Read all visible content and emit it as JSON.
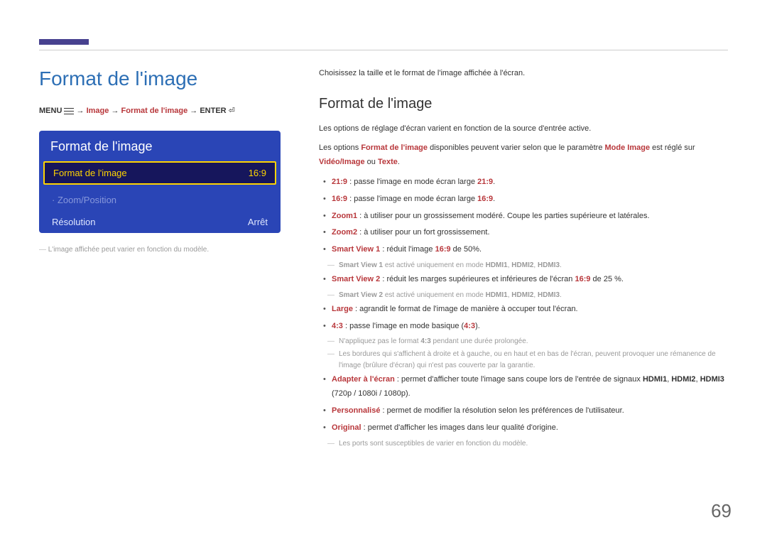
{
  "page_number": "69",
  "left": {
    "heading": "Format de l'image",
    "breadcrumb": {
      "menu": "MENU",
      "arrow": " → ",
      "image": "Image",
      "format": "Format de l'image",
      "enter": "ENTER",
      "enter_glyph": "⏎"
    },
    "panel": {
      "title": "Format de l'image",
      "selected_label": "Format de l'image",
      "selected_value": "16:9",
      "row_zoom": "· Zoom/Position",
      "row_resolution_label": "Résolution",
      "row_resolution_value": "Arrêt"
    },
    "footnote": "L'image affichée peut varier en fonction du modèle."
  },
  "right": {
    "intro": "Choisissez la taille et le format de l'image affichée à l'écran.",
    "heading": "Format de l'image",
    "p1": "Les options de réglage d'écran varient en fonction de la source d'entrée active.",
    "p2_a": "Les options ",
    "p2_b": "Format de l'image",
    "p2_c": " disponibles peuvent varier selon que le paramètre ",
    "p2_d": "Mode Image",
    "p2_e": " est réglé sur ",
    "p2_f": "Vidéo/Image",
    "p2_g": " ou ",
    "p2_h": "Texte",
    "p2_i": ".",
    "b1a": "21:9",
    "b1b": " : passe l'image en mode écran large ",
    "b1c": "21:9",
    "b1d": ".",
    "b2a": "16:9",
    "b2b": " : passe l'image en mode écran large ",
    "b2c": "16:9",
    "b2d": ".",
    "b3a": "Zoom1",
    "b3b": " : à utiliser pour un grossissement modéré. Coupe les parties supérieure et latérales.",
    "b4a": "Zoom2",
    "b4b": " : à utiliser pour un fort grossissement.",
    "b5a": "Smart View 1",
    "b5b": " : réduit l'image ",
    "b5c": "16:9",
    "b5d": " de 50%.",
    "sv1_a": "Smart View 1",
    "sv1_b": " est activé uniquement en mode ",
    "sv1_h1": "HDMI1",
    "sv1_h2": "HDMI2",
    "sv1_h3": "HDMI3",
    "b6a": "Smart View 2",
    "b6b": " : réduit les marges supérieures et inférieures de l'écran ",
    "b6c": "16:9",
    "b6d": " de 25 %.",
    "sv2_a": "Smart View 2",
    "sv2_b": " est activé uniquement en mode ",
    "b7a": "Large",
    "b7b": " : agrandit le format de l'image de manière à occuper tout l'écran.",
    "b8a": "4:3",
    "b8b": " : passe l'image en mode basique (",
    "b8c": "4:3",
    "b8d": ").",
    "n43a": "N'appliquez pas le format ",
    "n43b": "4:3",
    "n43c": " pendant une durée prolongée.",
    "n43d": "Les bordures qui s'affichent à droite et à gauche, ou en haut et en bas de l'écran, peuvent provoquer une rémanence de l'image (brûlure d'écran) qui n'est pas couverte par la garantie.",
    "b9a": "Adapter à l'écran",
    "b9b": " : permet d'afficher toute l'image sans coupe lors de l'entrée de signaux ",
    "b9c": " (720p / 1080i / 1080p).",
    "b10a": "Personnalisé",
    "b10b": " : permet de modifier la résolution selon les préférences de l'utilisateur.",
    "b11a": "Original",
    "b11b": " : permet d'afficher les images dans leur qualité d'origine.",
    "nports": "Les ports sont susceptibles de varier en fonction du modèle.",
    "comma": ", ",
    "period": "."
  }
}
